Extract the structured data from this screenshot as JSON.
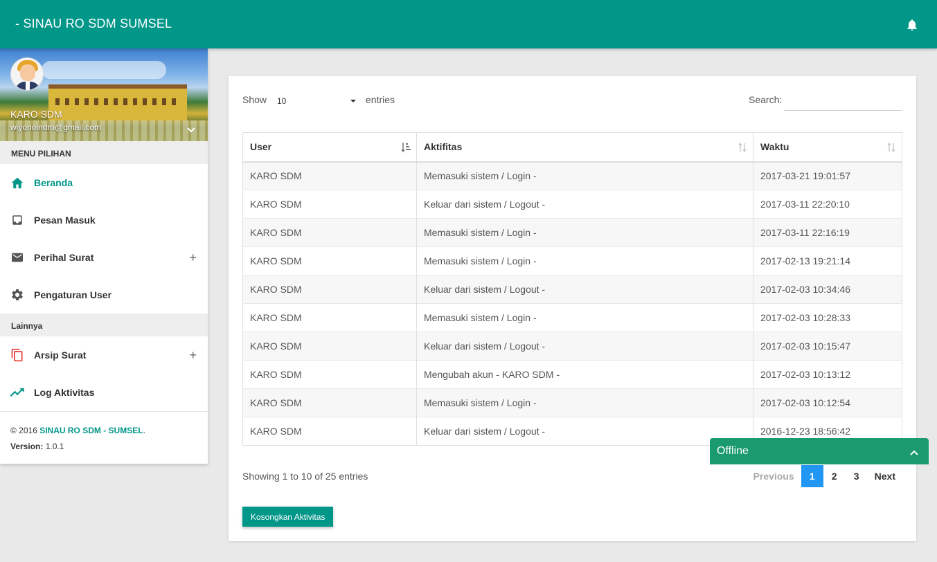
{
  "header": {
    "title": "- SINAU RO SDM SUMSEL",
    "icons": {
      "notifications": "bell-icon"
    }
  },
  "sidebar": {
    "user": {
      "name": "KARO SDM",
      "email": "wiyonoindro@gmail.com"
    },
    "section_main": "MENU PILIHAN",
    "items": [
      {
        "label": "Beranda",
        "icon": "home-icon",
        "active": true
      },
      {
        "label": "Pesan Masuk",
        "icon": "inbox-icon"
      },
      {
        "label": "Perihal Surat",
        "icon": "mail-icon",
        "expand": "+"
      },
      {
        "label": "Pengaturan User",
        "icon": "gear-icon"
      }
    ],
    "section_other": "Lainnya",
    "other_items": [
      {
        "label": "Arsip Surat",
        "icon": "copy-icon",
        "expand": "+"
      },
      {
        "label": "Log Aktivitas",
        "icon": "trending-icon"
      }
    ],
    "footer": {
      "copyright_prefix": "© 2016",
      "brand": "SINAU RO SDM - SUMSEL",
      "brand_suffix": ".",
      "version_label": "Version:",
      "version_value": "1.0.1"
    }
  },
  "table_controls": {
    "show_label": "Show",
    "page_length": "10",
    "entries_label": "entries",
    "search_label": "Search:",
    "search_value": ""
  },
  "table": {
    "columns": [
      "User",
      "Aktifitas",
      "Waktu"
    ],
    "rows": [
      [
        "KARO SDM",
        "Memasuki sistem / Login -",
        "2017-03-21 19:01:57"
      ],
      [
        "KARO SDM",
        "Keluar dari sistem / Logout -",
        "2017-03-11 22:20:10"
      ],
      [
        "KARO SDM",
        "Memasuki sistem / Login -",
        "2017-03-11 22:16:19"
      ],
      [
        "KARO SDM",
        "Memasuki sistem / Login -",
        "2017-02-13 19:21:14"
      ],
      [
        "KARO SDM",
        "Keluar dari sistem / Logout -",
        "2017-02-03 10:34:46"
      ],
      [
        "KARO SDM",
        "Memasuki sistem / Login -",
        "2017-02-03 10:28:33"
      ],
      [
        "KARO SDM",
        "Keluar dari sistem / Logout -",
        "2017-02-03 10:15:47"
      ],
      [
        "KARO SDM",
        "Mengubah akun - KARO SDM -",
        "2017-02-03 10:13:12"
      ],
      [
        "KARO SDM",
        "Memasuki sistem / Login -",
        "2017-02-03 10:12:54"
      ],
      [
        "KARO SDM",
        "Keluar dari sistem / Logout -",
        "2016-12-23 18:56:42"
      ]
    ]
  },
  "footer_info": "Showing 1 to 10 of 25 entries",
  "pagination": {
    "previous": "Previous",
    "pages": [
      "1",
      "2",
      "3"
    ],
    "current": "1",
    "next": "Next"
  },
  "action_button": "Kosongkan Aktivitas",
  "chat": {
    "status": "Offline"
  },
  "colors": {
    "primary": "#009688",
    "pager_active": "#2196f3",
    "chat": "#1a9a6e"
  }
}
